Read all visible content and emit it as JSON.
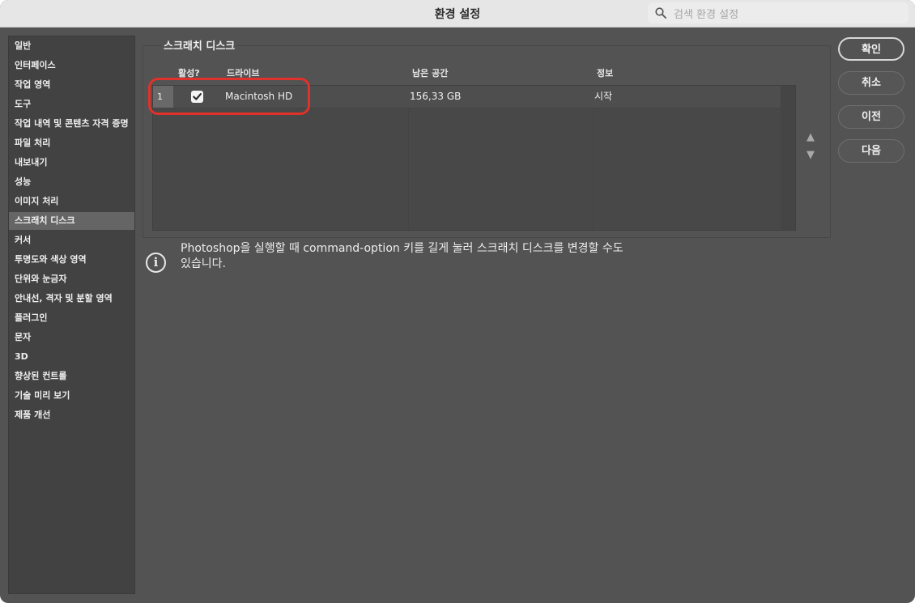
{
  "window": {
    "title": "환경 설정"
  },
  "search": {
    "placeholder": "검색 환경 설정"
  },
  "sidebar": {
    "items": [
      {
        "label": "일반"
      },
      {
        "label": "인터페이스"
      },
      {
        "label": "작업 영역"
      },
      {
        "label": "도구"
      },
      {
        "label": "작업 내역 및 콘텐츠 자격 증명"
      },
      {
        "label": "파일 처리"
      },
      {
        "label": "내보내기"
      },
      {
        "label": "성능"
      },
      {
        "label": "이미지 처리"
      },
      {
        "label": "스크래치 디스크",
        "selected": true
      },
      {
        "label": "커서"
      },
      {
        "label": "투명도와 색상 영역"
      },
      {
        "label": "단위와 눈금자"
      },
      {
        "label": "안내선, 격자 및 분할 영역"
      },
      {
        "label": "플러그인"
      },
      {
        "label": "문자"
      },
      {
        "label": "3D"
      },
      {
        "label": "향상된 컨트롤"
      },
      {
        "label": "기술 미리 보기"
      },
      {
        "label": "제품 개선"
      }
    ]
  },
  "scratch": {
    "group_title": "스크래치 디스크",
    "columns": {
      "active": "활성?",
      "drive": "드라이브",
      "free": "남은 공간",
      "info": "정보"
    },
    "rows": [
      {
        "index": "1",
        "active": true,
        "drive": "Macintosh HD",
        "free": "156,33 GB",
        "info": "시작"
      }
    ],
    "up_arrow": "▲",
    "down_arrow": "▼"
  },
  "info": {
    "icon": "i",
    "line1": "Photoshop을 실행할 때 command-option 키를 길게 눌러 스크래치 디스크를 변경할 수도",
    "line2": "있습니다."
  },
  "buttons": {
    "ok": "확인",
    "cancel": "취소",
    "prev": "이전",
    "next": "다음"
  },
  "colors": {
    "panel": "#535353",
    "sidebar": "#424242",
    "selected": "#656565",
    "highlight": "#e0312a"
  }
}
